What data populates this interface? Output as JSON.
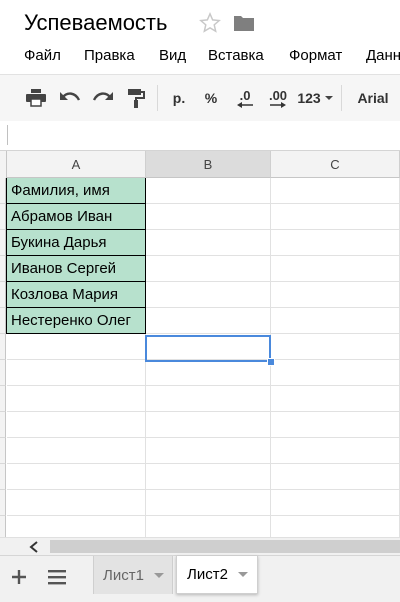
{
  "document": {
    "title": "Успеваемость"
  },
  "menu": {
    "items": [
      "Файл",
      "Правка",
      "Вид",
      "Вставка",
      "Формат",
      "Данн"
    ]
  },
  "toolbar": {
    "currency_label": "р.",
    "percent_label": "%",
    "decrease_decimals_label": ".0",
    "increase_decimals_label": ".00",
    "number_format_label": "123",
    "font_label": "Arial"
  },
  "grid": {
    "columns": [
      "A",
      "B",
      "C"
    ],
    "rows": [
      "Фамилия, имя",
      "Абрамов Иван",
      "Букина Дарья",
      "Иванов Сергей",
      "Козлова Мария",
      "Нестеренко Олег"
    ],
    "selected_cell": "B7"
  },
  "sheets": {
    "tabs": [
      {
        "label": "Лист1",
        "active": false
      },
      {
        "label": "Лист2",
        "active": true
      }
    ]
  },
  "colors": {
    "filled_cell": "#b7e1cd",
    "selection": "#4a89dc",
    "active_column_header": "#dcdcdc"
  }
}
